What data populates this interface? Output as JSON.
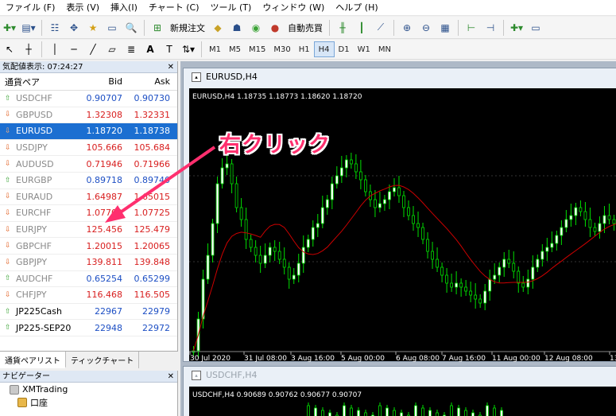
{
  "menu": [
    "ファイル (F)",
    "表示 (V)",
    "挿入(I)",
    "チャート (C)",
    "ツール (T)",
    "ウィンドウ (W)",
    "ヘルプ (H)"
  ],
  "toolbar": {
    "new_order": "新規注文",
    "autotrade": "自動売買"
  },
  "timeframes": [
    "M1",
    "M5",
    "M15",
    "M30",
    "H1",
    "H4",
    "D1",
    "W1",
    "MN"
  ],
  "active_timeframe": "H4",
  "market_watch": {
    "title": "気配値表示: 07:24:27",
    "headers": {
      "symbol": "通貨ペア",
      "bid": "Bid",
      "ask": "Ask"
    },
    "rows": [
      {
        "symbol": "USDCHF",
        "bid": "0.90707",
        "ask": "0.90730",
        "dir": "up",
        "color": "blue"
      },
      {
        "symbol": "GBPUSD",
        "bid": "1.32308",
        "ask": "1.32331",
        "dir": "down",
        "color": "red"
      },
      {
        "symbol": "EURUSD",
        "bid": "1.18720",
        "ask": "1.18738",
        "dir": "down",
        "color": "red",
        "selected": true
      },
      {
        "symbol": "USDJPY",
        "bid": "105.666",
        "ask": "105.684",
        "dir": "down",
        "color": "red"
      },
      {
        "symbol": "AUDUSD",
        "bid": "0.71946",
        "ask": "0.71966",
        "dir": "down",
        "color": "red"
      },
      {
        "symbol": "EURGBP",
        "bid": "0.89718",
        "ask": "0.89740",
        "dir": "up",
        "color": "blue"
      },
      {
        "symbol": "EURAUD",
        "bid": "1.64987",
        "ask": "1.65015",
        "dir": "down",
        "color": "red"
      },
      {
        "symbol": "EURCHF",
        "bid": "1.07700",
        "ask": "1.07725",
        "dir": "down",
        "color": "red"
      },
      {
        "symbol": "EURJPY",
        "bid": "125.456",
        "ask": "125.479",
        "dir": "down",
        "color": "red"
      },
      {
        "symbol": "GBPCHF",
        "bid": "1.20015",
        "ask": "1.20065",
        "dir": "down",
        "color": "red"
      },
      {
        "symbol": "GBPJPY",
        "bid": "139.811",
        "ask": "139.848",
        "dir": "down",
        "color": "red"
      },
      {
        "symbol": "AUDCHF",
        "bid": "0.65254",
        "ask": "0.65299",
        "dir": "up",
        "color": "blue"
      },
      {
        "symbol": "CHFJPY",
        "bid": "116.468",
        "ask": "116.505",
        "dir": "down",
        "color": "red"
      },
      {
        "symbol": "JP225Cash",
        "bid": "22967",
        "ask": "22979",
        "dir": "up",
        "color": "blue",
        "dark": true
      },
      {
        "symbol": "JP225-SEP20",
        "bid": "22948",
        "ask": "22972",
        "dir": "up",
        "color": "blue",
        "dark": true
      }
    ],
    "tabs": [
      "通貨ペアリスト",
      "ティックチャート"
    ]
  },
  "navigator": {
    "title": "ナビゲーター",
    "items": [
      "XMTrading",
      "口座"
    ]
  },
  "charts": {
    "main": {
      "window_title": "EURUSD,H4",
      "info": "EURUSD,H4  1.18735 1.18773 1.18620 1.18720",
      "date_labels": [
        "30 Jul 2020",
        "31 Jul 08:00",
        "3 Aug 16:00",
        "5 Aug 00:00",
        "6 Aug 08:00",
        "7 Aug 16:00",
        "11 Aug 00:00",
        "12 Aug 08:00",
        "13"
      ]
    },
    "second": {
      "window_title": "USDCHF,H4",
      "info": "USDCHF,H4  0.90689 0.90762 0.90677 0.90707"
    }
  },
  "annotation": "右クリック",
  "colors": {
    "bull": "#ffffff",
    "bear": "#00e000",
    "ma": "#cc0000",
    "accent": "#ff2f6e",
    "selected_row": "#1c6fd1"
  }
}
